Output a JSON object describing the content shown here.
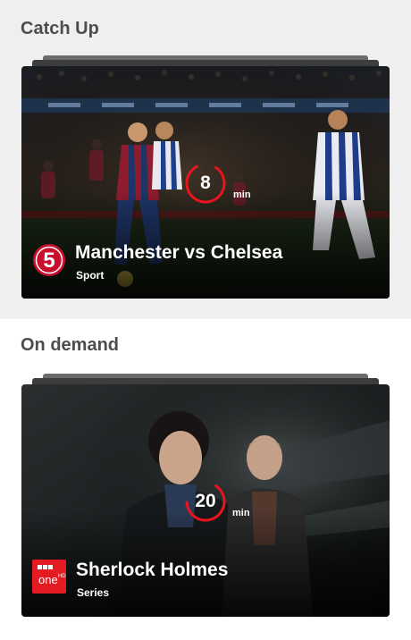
{
  "sections": [
    {
      "heading": "Catch Up",
      "card": {
        "minutes": "8",
        "minutes_unit": "min",
        "channel_logo_text": "5",
        "title": "Manchester vs Chelsea",
        "category": "Sport"
      }
    },
    {
      "heading": "On demand",
      "card": {
        "minutes": "20",
        "minutes_unit": "min",
        "channel_logo_text": "BBC one HD",
        "title": "Sherlock Holmes",
        "category": "Series"
      }
    }
  ],
  "colors": {
    "section_bg": "#efefef",
    "heading": "#4d4d4d",
    "timer_ring": "#e8141e",
    "channel5_red": "#c8102e",
    "bbc_one_red": "#e51b24"
  },
  "icons": {
    "timer": "countdown-ring-icon",
    "channel5": "channel-5-logo",
    "bbcone": "bbc-one-hd-logo"
  }
}
